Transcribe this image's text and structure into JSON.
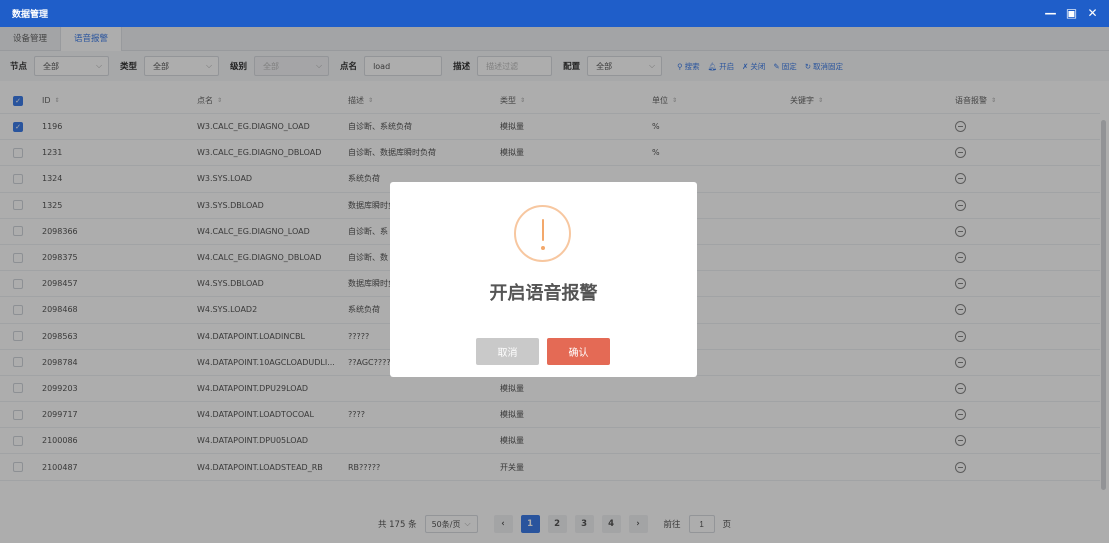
{
  "window": {
    "title": "数据管理",
    "min_icon": "minimize-icon",
    "max_icon": "maximize-icon",
    "close_icon": "close-icon"
  },
  "tabs": [
    {
      "label": "设备管理",
      "active": false
    },
    {
      "label": "语音报警",
      "active": true
    }
  ],
  "filters": {
    "node_label": "节点",
    "node_value": "全部",
    "type_label": "类型",
    "type_value": "全部",
    "level_label": "级别",
    "level_value": "全部",
    "point_label": "点名",
    "point_value": "load",
    "desc_label": "描述",
    "desc_placeholder": "描述过滤",
    "config_label": "配置",
    "config_value": "全部"
  },
  "actions": [
    {
      "icon": "search-icon",
      "label": "搜索"
    },
    {
      "icon": "bell-icon",
      "label": "开启"
    },
    {
      "icon": "mute-icon",
      "label": "关闭"
    },
    {
      "icon": "lock-icon",
      "label": "固定"
    },
    {
      "icon": "undo-icon",
      "label": "取消固定"
    }
  ],
  "table": {
    "headers": {
      "id": "ID",
      "name": "点名",
      "desc": "描述",
      "type": "类型",
      "unit": "单位",
      "keyword": "关键字",
      "voice": "语音报警"
    },
    "rows": [
      {
        "checked": true,
        "id": "1196",
        "name": "W3.CALC_EG.DIAGNO_LOAD",
        "desc": "自诊断、系统负荷",
        "type": "模拟量",
        "unit": "%"
      },
      {
        "checked": false,
        "id": "1231",
        "name": "W3.CALC_EG.DIAGNO_DBLOAD",
        "desc": "自诊断、数据库瞬时负荷",
        "type": "模拟量",
        "unit": "%"
      },
      {
        "checked": false,
        "id": "1324",
        "name": "W3.SYS.LOAD",
        "desc": "系统负荷",
        "type": "",
        "unit": ""
      },
      {
        "checked": false,
        "id": "1325",
        "name": "W3.SYS.DBLOAD",
        "desc": "数据库瞬时负",
        "type": "",
        "unit": ""
      },
      {
        "checked": false,
        "id": "2098366",
        "name": "W4.CALC_EG.DIAGNO_LOAD",
        "desc": "自诊断、系",
        "type": "",
        "unit": ""
      },
      {
        "checked": false,
        "id": "2098375",
        "name": "W4.CALC_EG.DIAGNO_DBLOAD",
        "desc": "自诊断、数",
        "type": "",
        "unit": ""
      },
      {
        "checked": false,
        "id": "2098457",
        "name": "W4.SYS.DBLOAD",
        "desc": "数据库瞬时负",
        "type": "",
        "unit": ""
      },
      {
        "checked": false,
        "id": "2098468",
        "name": "W4.SYS.LOAD2",
        "desc": "系统负荷",
        "type": "",
        "unit": ""
      },
      {
        "checked": false,
        "id": "2098563",
        "name": "W4.DATAPOINT.LOADINCBL",
        "desc": "?????",
        "type": "",
        "unit": ""
      },
      {
        "checked": false,
        "id": "2098784",
        "name": "W4.DATAPOINT.10AGCLOADUDLI...",
        "desc": "??AGC????",
        "type": "",
        "unit": ""
      },
      {
        "checked": false,
        "id": "2099203",
        "name": "W4.DATAPOINT.DPU29LOAD",
        "desc": "",
        "type": "模拟量",
        "unit": ""
      },
      {
        "checked": false,
        "id": "2099717",
        "name": "W4.DATAPOINT.LOADTOCOAL",
        "desc": "????",
        "type": "模拟量",
        "unit": ""
      },
      {
        "checked": false,
        "id": "2100086",
        "name": "W4.DATAPOINT.DPU05LOAD",
        "desc": "",
        "type": "模拟量",
        "unit": ""
      },
      {
        "checked": false,
        "id": "2100487",
        "name": "W4.DATAPOINT.LOADSTEAD_RB",
        "desc": "RB?????",
        "type": "开关量",
        "unit": ""
      }
    ]
  },
  "pager": {
    "total": "共 175 条",
    "page_size": "50条/页",
    "pages": [
      "1",
      "2",
      "3",
      "4"
    ],
    "current": "1",
    "goto_label": "前往",
    "goto_value": "1",
    "page_suffix": "页"
  },
  "dialog": {
    "title": "开启语音报警",
    "cancel_label": "取消",
    "confirm_label": "确认",
    "icon": "warning-icon"
  },
  "colors": {
    "titlebar": "#1f5ec9",
    "accent": "#3d7ce8",
    "confirm": "#e46a55",
    "warning": "#f3a86b"
  }
}
